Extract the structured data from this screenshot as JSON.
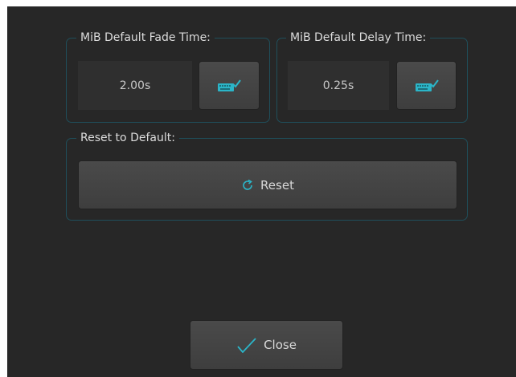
{
  "fade_group": {
    "title": "MiB Default Fade Time:",
    "value": "2.00s",
    "edit_icon": "keyboard-edit-icon"
  },
  "delay_group": {
    "title": "MiB Default Delay Time:",
    "value": "0.25s",
    "edit_icon": "keyboard-edit-icon"
  },
  "reset_group": {
    "title": "Reset to Default:",
    "button_label": "Reset",
    "button_icon": "refresh-icon"
  },
  "footer": {
    "close_label": "Close",
    "close_icon": "checkmark-icon"
  },
  "colors": {
    "accent": "#2bb5c8",
    "background": "#272727",
    "group_border": "#1f4f5b"
  }
}
